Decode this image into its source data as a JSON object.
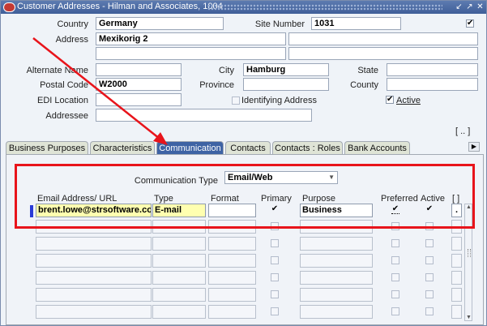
{
  "window": {
    "title": "Customer Addresses - Hilman and Associates, 1004",
    "controls": [
      "↙",
      "↗",
      "✕"
    ]
  },
  "form": {
    "country_label": "Country",
    "country_value": "Germany",
    "site_number_label": "Site Number",
    "site_number_value": "1031",
    "address_label": "Address",
    "address_line1": "Mexikorig 2",
    "alternate_name_label": "Alternate Name",
    "city_label": "City",
    "city_value": "Hamburg",
    "state_label": "State",
    "postal_code_label": "Postal Code",
    "postal_code_value": "W2000",
    "province_label": "Province",
    "county_label": "County",
    "edi_location_label": "EDI Location",
    "identifying_address_label": "Identifying Address",
    "active_label": "Active",
    "addressee_label": "Addressee"
  },
  "tabs": [
    "Business Purposes",
    "Characteristics",
    "Communication",
    "Contacts",
    "Contacts : Roles",
    "Bank Accounts"
  ],
  "selected_tab": "Communication",
  "communication": {
    "type_label": "Communication Type",
    "type_value": "Email/Web",
    "headers": {
      "email": "Email Address/ URL",
      "type": "Type",
      "format": "Format",
      "primary": "Primary",
      "purpose": "Purpose",
      "preferred": "Preferred",
      "active": "Active",
      "flex": "[ ]"
    },
    "rows": [
      {
        "email": "brent.lowe@strsoftware.com",
        "type": "E-mail",
        "format": "",
        "primary": true,
        "purpose": "Business",
        "preferred": true,
        "active": true
      }
    ]
  },
  "misc": {
    "bracket_btn": "[ .. ]",
    "row_dot": "."
  }
}
